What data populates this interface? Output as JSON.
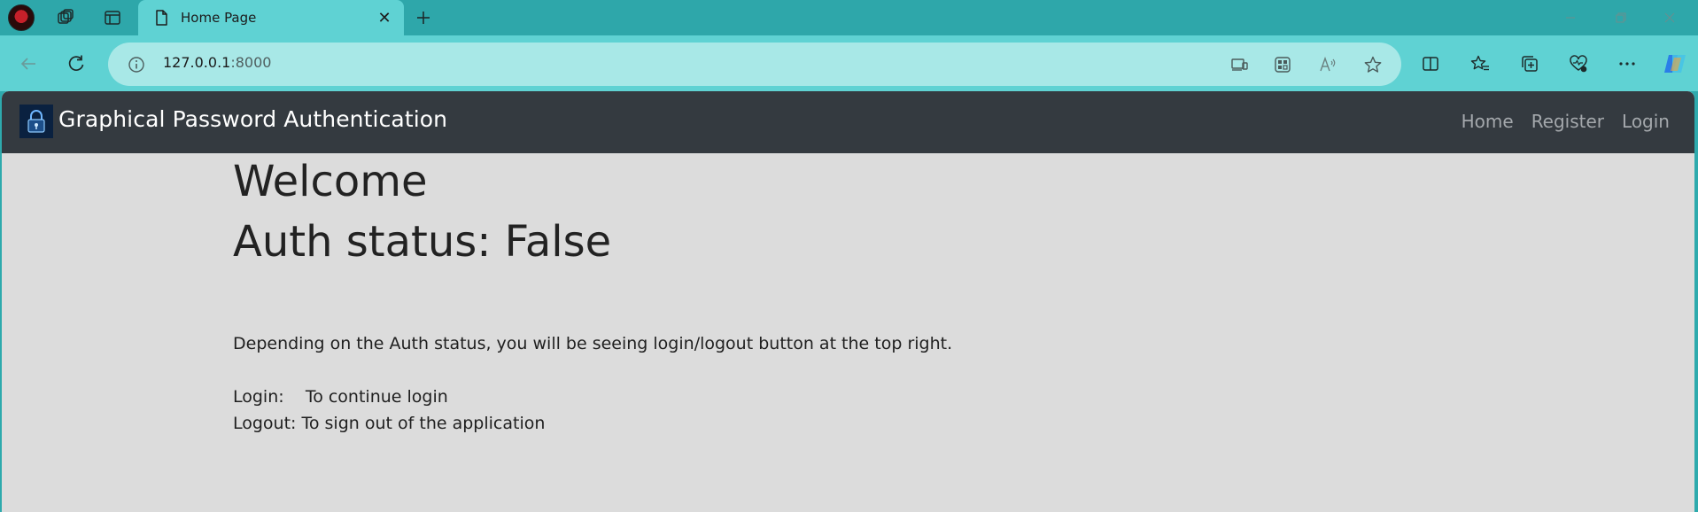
{
  "browser": {
    "tab": {
      "title": "Home Page",
      "close_glyph": "✕",
      "icon": "page-icon"
    },
    "new_tab_glyph": "+",
    "window_controls": {
      "minimize": "—",
      "restore": "❐",
      "close": "✕"
    },
    "address": {
      "host": "127.0.0.1",
      "port": ":8000"
    },
    "colors": {
      "tabstrip": "#2ea7aa",
      "toolbar": "#5fd2d3",
      "address_bar": "#a8e8e7"
    }
  },
  "site": {
    "brand": "Graphical Password Authentication",
    "nav": [
      "Home",
      "Register",
      "Login"
    ],
    "colors": {
      "navbar": "#343a40",
      "page_bg": "#dcdcdc"
    }
  },
  "content": {
    "welcome": "Welcome",
    "status": "Auth status: False",
    "description": "Depending on the Auth status, you will be seeing login/logout button at the top right.",
    "login_line": "Login:    To continue login",
    "logout_line": "Logout: To sign out of the application"
  }
}
